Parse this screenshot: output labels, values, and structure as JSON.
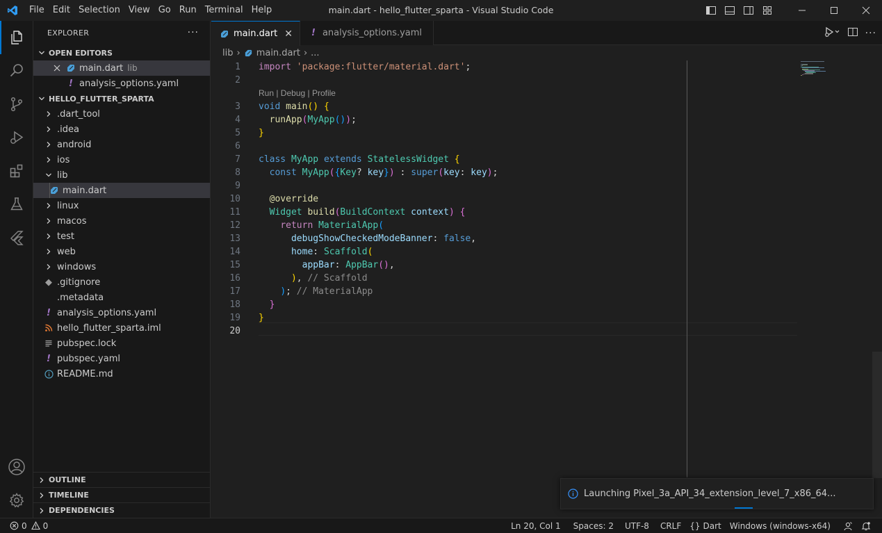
{
  "titlebar": {
    "title": "main.dart - hello_flutter_sparta - Visual Studio Code",
    "menu": [
      "File",
      "Edit",
      "Selection",
      "View",
      "Go",
      "Run",
      "Terminal",
      "Help"
    ]
  },
  "sidebar": {
    "title": "EXPLORER",
    "open_editors": {
      "label": "OPEN EDITORS",
      "items": [
        {
          "name": "main.dart",
          "desc": "lib"
        },
        {
          "name": "analysis_options.yaml"
        }
      ]
    },
    "project": {
      "label": "HELLO_FLUTTER_SPARTA",
      "items": [
        {
          "name": ".dart_tool"
        },
        {
          "name": ".idea"
        },
        {
          "name": "android"
        },
        {
          "name": "ios"
        },
        {
          "name": "lib"
        },
        {
          "name": "main.dart"
        },
        {
          "name": "linux"
        },
        {
          "name": "macos"
        },
        {
          "name": "test"
        },
        {
          "name": "web"
        },
        {
          "name": "windows"
        },
        {
          "name": ".gitignore"
        },
        {
          "name": ".metadata"
        },
        {
          "name": "analysis_options.yaml"
        },
        {
          "name": "hello_flutter_sparta.iml"
        },
        {
          "name": "pubspec.lock"
        },
        {
          "name": "pubspec.yaml"
        },
        {
          "name": "README.md"
        }
      ]
    },
    "outline": "OUTLINE",
    "timeline": "TIMELINE",
    "dependencies": "DEPENDENCIES"
  },
  "tabs": [
    {
      "label": "main.dart"
    },
    {
      "label": "analysis_options.yaml"
    }
  ],
  "breadcrumb": {
    "folder": "lib",
    "file": "main.dart",
    "more": "..."
  },
  "codelens": "Run | Debug | Profile",
  "line_numbers": [
    "1",
    "2",
    "3",
    "4",
    "5",
    "6",
    "7",
    "8",
    "9",
    "10",
    "11",
    "12",
    "13",
    "14",
    "15",
    "16",
    "17",
    "18",
    "19",
    "20"
  ],
  "code": {
    "l1_kw": "import",
    "l1_str": "'package:flutter/material.dart'",
    "l1_end": ";",
    "l3_kw": "void",
    "l3_fn": "main",
    "l3_paren": "()",
    "l3_brace": "{",
    "l4_fn": "runApp",
    "l4_open": "(",
    "l4_type": "MyApp",
    "l4_inner": "()",
    "l4_close": ")",
    "l4_end": ";",
    "l5_brace": "}",
    "l7_kw": "class",
    "l7_name": "MyApp",
    "l7_ext": "extends",
    "l7_super": "StatelessWidget",
    "l7_brace": "{",
    "l8_kw": "const",
    "l8_name": "MyApp",
    "l8_open": "(",
    "l8_b1": "{",
    "l8_type": "Key",
    "l8_q": "?",
    "l8_key": "key",
    "l8_b2": "}",
    "l8_close": ")",
    "l8_colon": " :",
    "l8_super": "super",
    "l8_p1": "(",
    "l8_k": "key",
    "l8_c": ": ",
    "l8_v": "key",
    "l8_p2": ")",
    "l8_end": ";",
    "l10_ann": "@override",
    "l11_type": "Widget",
    "l11_fn": "build",
    "l11_open": "(",
    "l11_ptype": "BuildContext",
    "l11_pname": "context",
    "l11_close": ")",
    "l11_brace": "{",
    "l12_kw": "return",
    "l12_type": "MaterialApp",
    "l12_open": "(",
    "l13_prop": "debugShowCheckedModeBanner",
    "l13_c": ": ",
    "l13_val": "false",
    "l13_end": ",",
    "l14_prop": "home",
    "l14_c": ": ",
    "l14_type": "Scaffold",
    "l14_open": "(",
    "l15_prop": "appBar",
    "l15_c": ": ",
    "l15_type": "AppBar",
    "l15_paren": "()",
    "l15_end": ",",
    "l16_close": ")",
    "l16_end": ", ",
    "l16_cmt": "// Scaffold",
    "l17_close": ")",
    "l17_end": "; ",
    "l17_cmt": "// MaterialApp",
    "l18_brace": "}",
    "l19_brace": "}"
  },
  "notification": "Launching Pixel_3a_API_34_extension_level_7_x86_64...",
  "status": {
    "errors": "0",
    "warnings": "0",
    "position": "Ln 20, Col 1",
    "spaces": "Spaces: 2",
    "encoding": "UTF-8",
    "eol": "CRLF",
    "language": "Dart",
    "device": "Windows (windows-x64)"
  },
  "colors": {
    "accent": "#0078d4",
    "background": "#1f1f1f",
    "sidebar": "#181818"
  }
}
